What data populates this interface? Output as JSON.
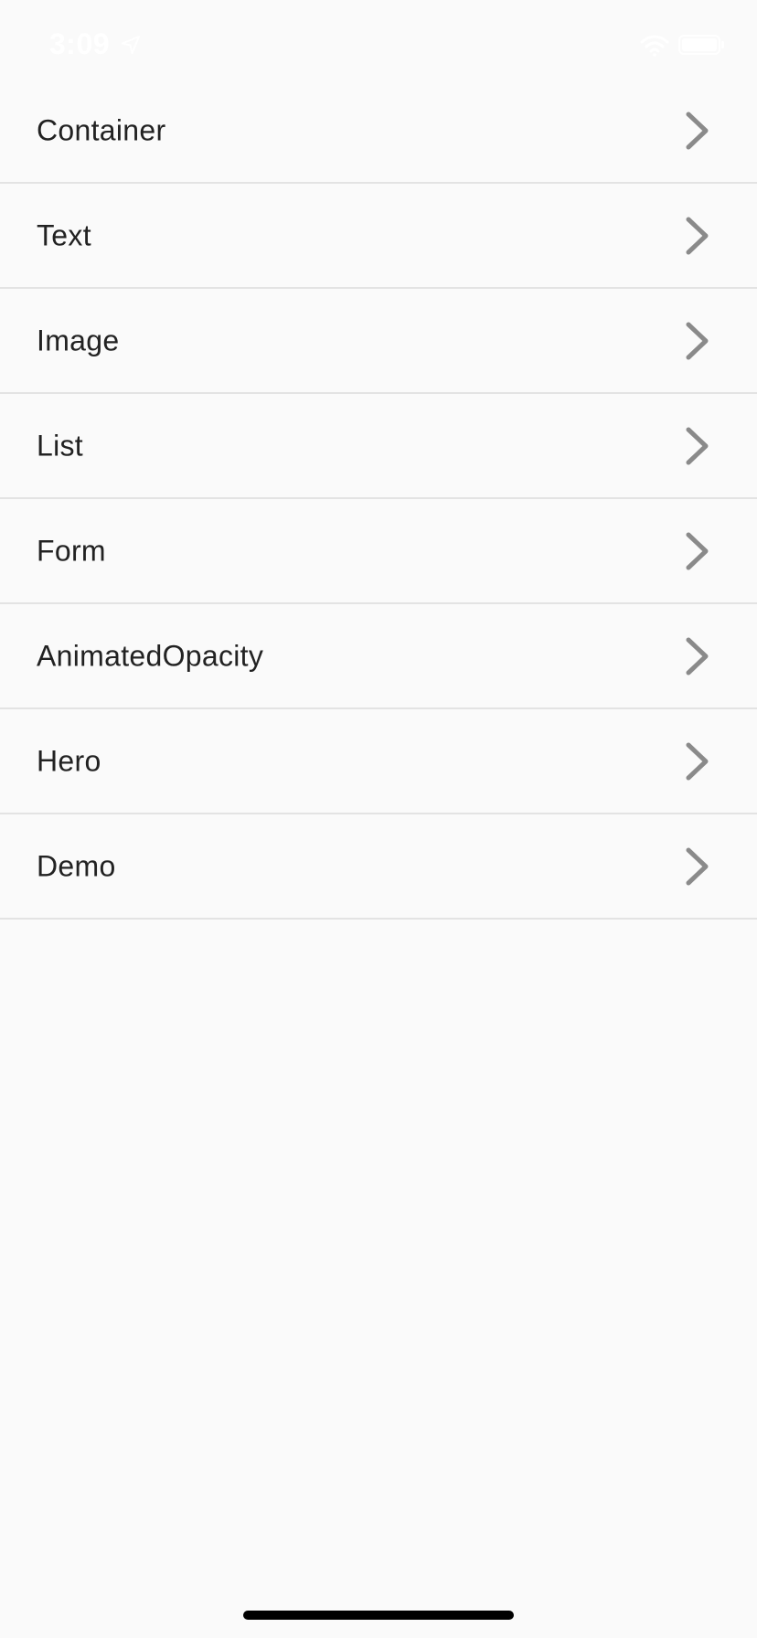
{
  "status_bar": {
    "time": "3:09",
    "location_icon": "location-arrow-icon",
    "wifi_icon": "wifi-icon",
    "battery_icon": "battery-icon"
  },
  "list": {
    "items": [
      {
        "label": "Container",
        "icon": "chevron-right-icon"
      },
      {
        "label": "Text",
        "icon": "chevron-right-icon"
      },
      {
        "label": "Image",
        "icon": "chevron-right-icon"
      },
      {
        "label": "List",
        "icon": "chevron-right-icon"
      },
      {
        "label": "Form",
        "icon": "chevron-right-icon"
      },
      {
        "label": "AnimatedOpacity",
        "icon": "chevron-right-icon"
      },
      {
        "label": "Hero",
        "icon": "chevron-right-icon"
      },
      {
        "label": "Demo",
        "icon": "chevron-right-icon"
      }
    ]
  },
  "colors": {
    "background": "#fafafa",
    "divider": "#e3e3e3",
    "label_text": "#222222",
    "chevron": "#8a8a8a",
    "home_indicator": "#000000"
  }
}
